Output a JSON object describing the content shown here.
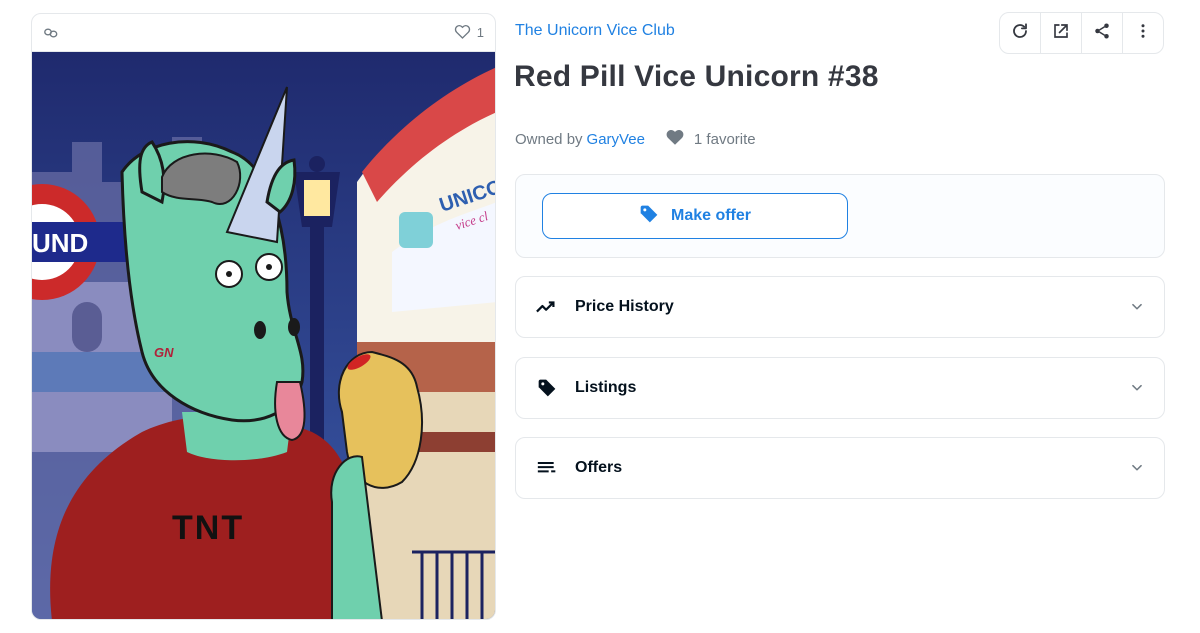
{
  "media": {
    "favorite_count": "1",
    "shirt_text": "TNT",
    "tag_text": "GN",
    "sign_text": "UND",
    "banner_text": "UNICO",
    "banner_sub": "vice cl"
  },
  "item": {
    "collection_name": "The Unicorn Vice Club",
    "title": "Red Pill Vice Unicorn #38",
    "owned_by_label": "Owned by",
    "owner_name": "GaryVee",
    "favorites_label": "1 favorite"
  },
  "actions": {
    "make_offer_label": "Make offer"
  },
  "sections": [
    {
      "label": "Price History",
      "icon": "trending-icon"
    },
    {
      "label": "Listings",
      "icon": "tag-icon"
    },
    {
      "label": "Offers",
      "icon": "list-icon"
    }
  ],
  "toolbar": [
    "refresh-icon",
    "external-link-icon",
    "share-icon",
    "more-vertical-icon"
  ],
  "colors": {
    "accent": "#2081e2",
    "text": "#353840",
    "muted": "#707a83",
    "border": "#e5e8eb"
  }
}
